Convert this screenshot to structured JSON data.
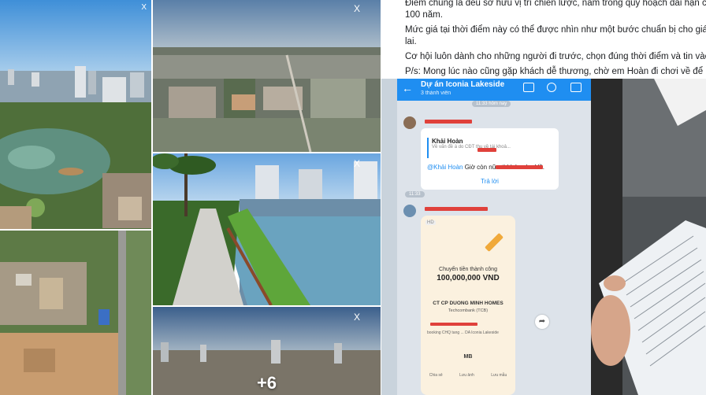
{
  "post": {
    "line1": "Điểm chung là đều sở hữu vị trí chiến lược, nằm trong quy hoạch dài hạn của Th",
    "line2": "100 năm.",
    "line3": "Mức giá tại thời điểm này có thể được nhìn như một bước chuẩn bị cho giá trị tớ",
    "line4": "lai.",
    "line5": "Cơ hội luôn dành cho những người đi trước, chọn đúng thời điểm và tin vào giá",
    "line6": "P/s: Mong lúc nào cũng gặp khách dễ thương, chờ em Hoàn đi chơi về để bookin"
  },
  "photos": {
    "more_count": "+6",
    "watermark": "X"
  },
  "chat": {
    "title": "Dự án Iconia Lakeside",
    "subtitle": "3 thành viên",
    "time1": "11:33 hôm nay",
    "quote_name": "Khải Hoàn",
    "quote_text": "Về vấn đề            à do CĐT thu về tái khoả...",
    "mention_name": "@Khải Hoàn",
    "mention_text": " Giờ còn                    nữa thì bán cho Hồ.",
    "reply_label": "Trả lời",
    "time2": "11:33",
    "receipt_tag": "HD",
    "receipt_title": "Chuyển tiền thành công",
    "receipt_amount": "100,000,000 VND",
    "receipt_company": "CT CP DUONG MINH HOMES",
    "receipt_bank": "Techcombank (TCB)",
    "receipt_note": "booking CHQ tang ... DA Iconia Lakeside",
    "receipt_brand": "MB",
    "receipt_actions": [
      "Chia sẻ",
      "Lưu ảnh",
      "Lưu mẫu"
    ]
  },
  "colors": {
    "zalo_blue": "#1f8ef1",
    "redaction": "#e0413b"
  }
}
